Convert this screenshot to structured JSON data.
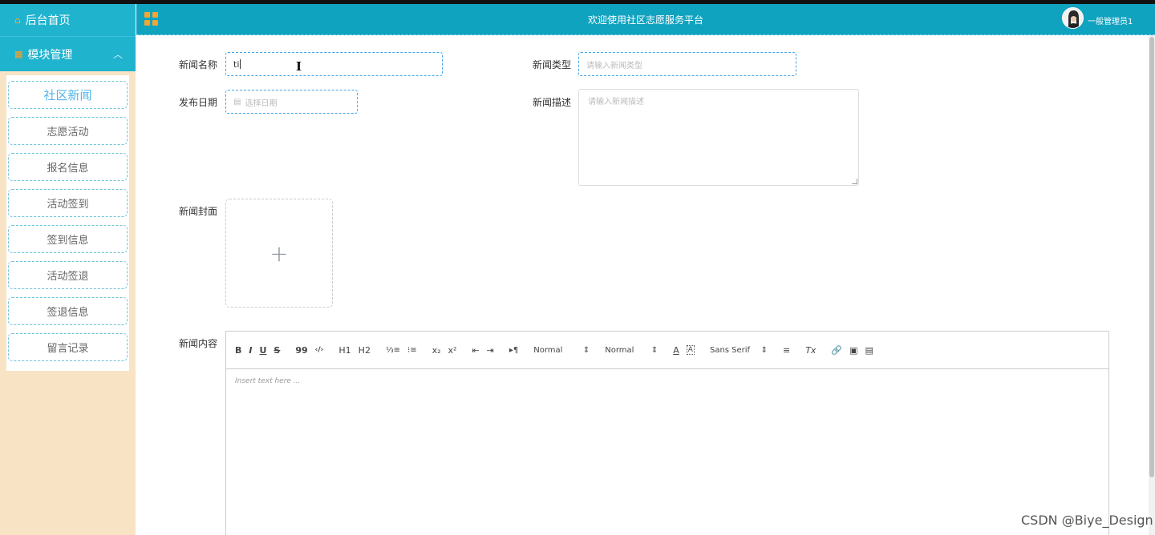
{
  "sidebar": {
    "home_label": "后台首页",
    "module_label": "模块管理",
    "items": [
      {
        "label": "社区新闻",
        "active": true
      },
      {
        "label": "志愿活动"
      },
      {
        "label": "报名信息"
      },
      {
        "label": "活动签到"
      },
      {
        "label": "签到信息"
      },
      {
        "label": "活动签退"
      },
      {
        "label": "签退信息"
      },
      {
        "label": "留言记录"
      }
    ]
  },
  "header": {
    "title": "欢迎使用社区志愿服务平台",
    "user_name": "一般管理员1"
  },
  "form": {
    "name_label": "新闻名称",
    "name_value": "ti",
    "type_label": "新闻类型",
    "type_placeholder": "请输入新闻类型",
    "date_label": "发布日期",
    "date_placeholder": "选择日期",
    "desc_label": "新闻描述",
    "desc_placeholder": "请输入新闻描述",
    "cover_label": "新闻封面",
    "content_label": "新闻内容"
  },
  "editor": {
    "toolbar": {
      "bold": "B",
      "italic": "I",
      "underline": "U",
      "strike": "S",
      "quote": "99",
      "code": "‹/›",
      "h1": "H1",
      "h2": "H2",
      "ordered_list": "⅓≡",
      "bullet_list": "⁝≡",
      "subscript": "x₂",
      "superscript": "x²",
      "outdent": "⇤",
      "indent": "⇥",
      "direction": "▸¶",
      "size_select": "Normal",
      "header_select": "Normal",
      "color": "A",
      "background": "A",
      "font_select": "Sans Serif",
      "align": "≡",
      "clean": "Tx"
    },
    "placeholder": "Insert text here ..."
  },
  "watermark": "CSDN @Biye_Design"
}
